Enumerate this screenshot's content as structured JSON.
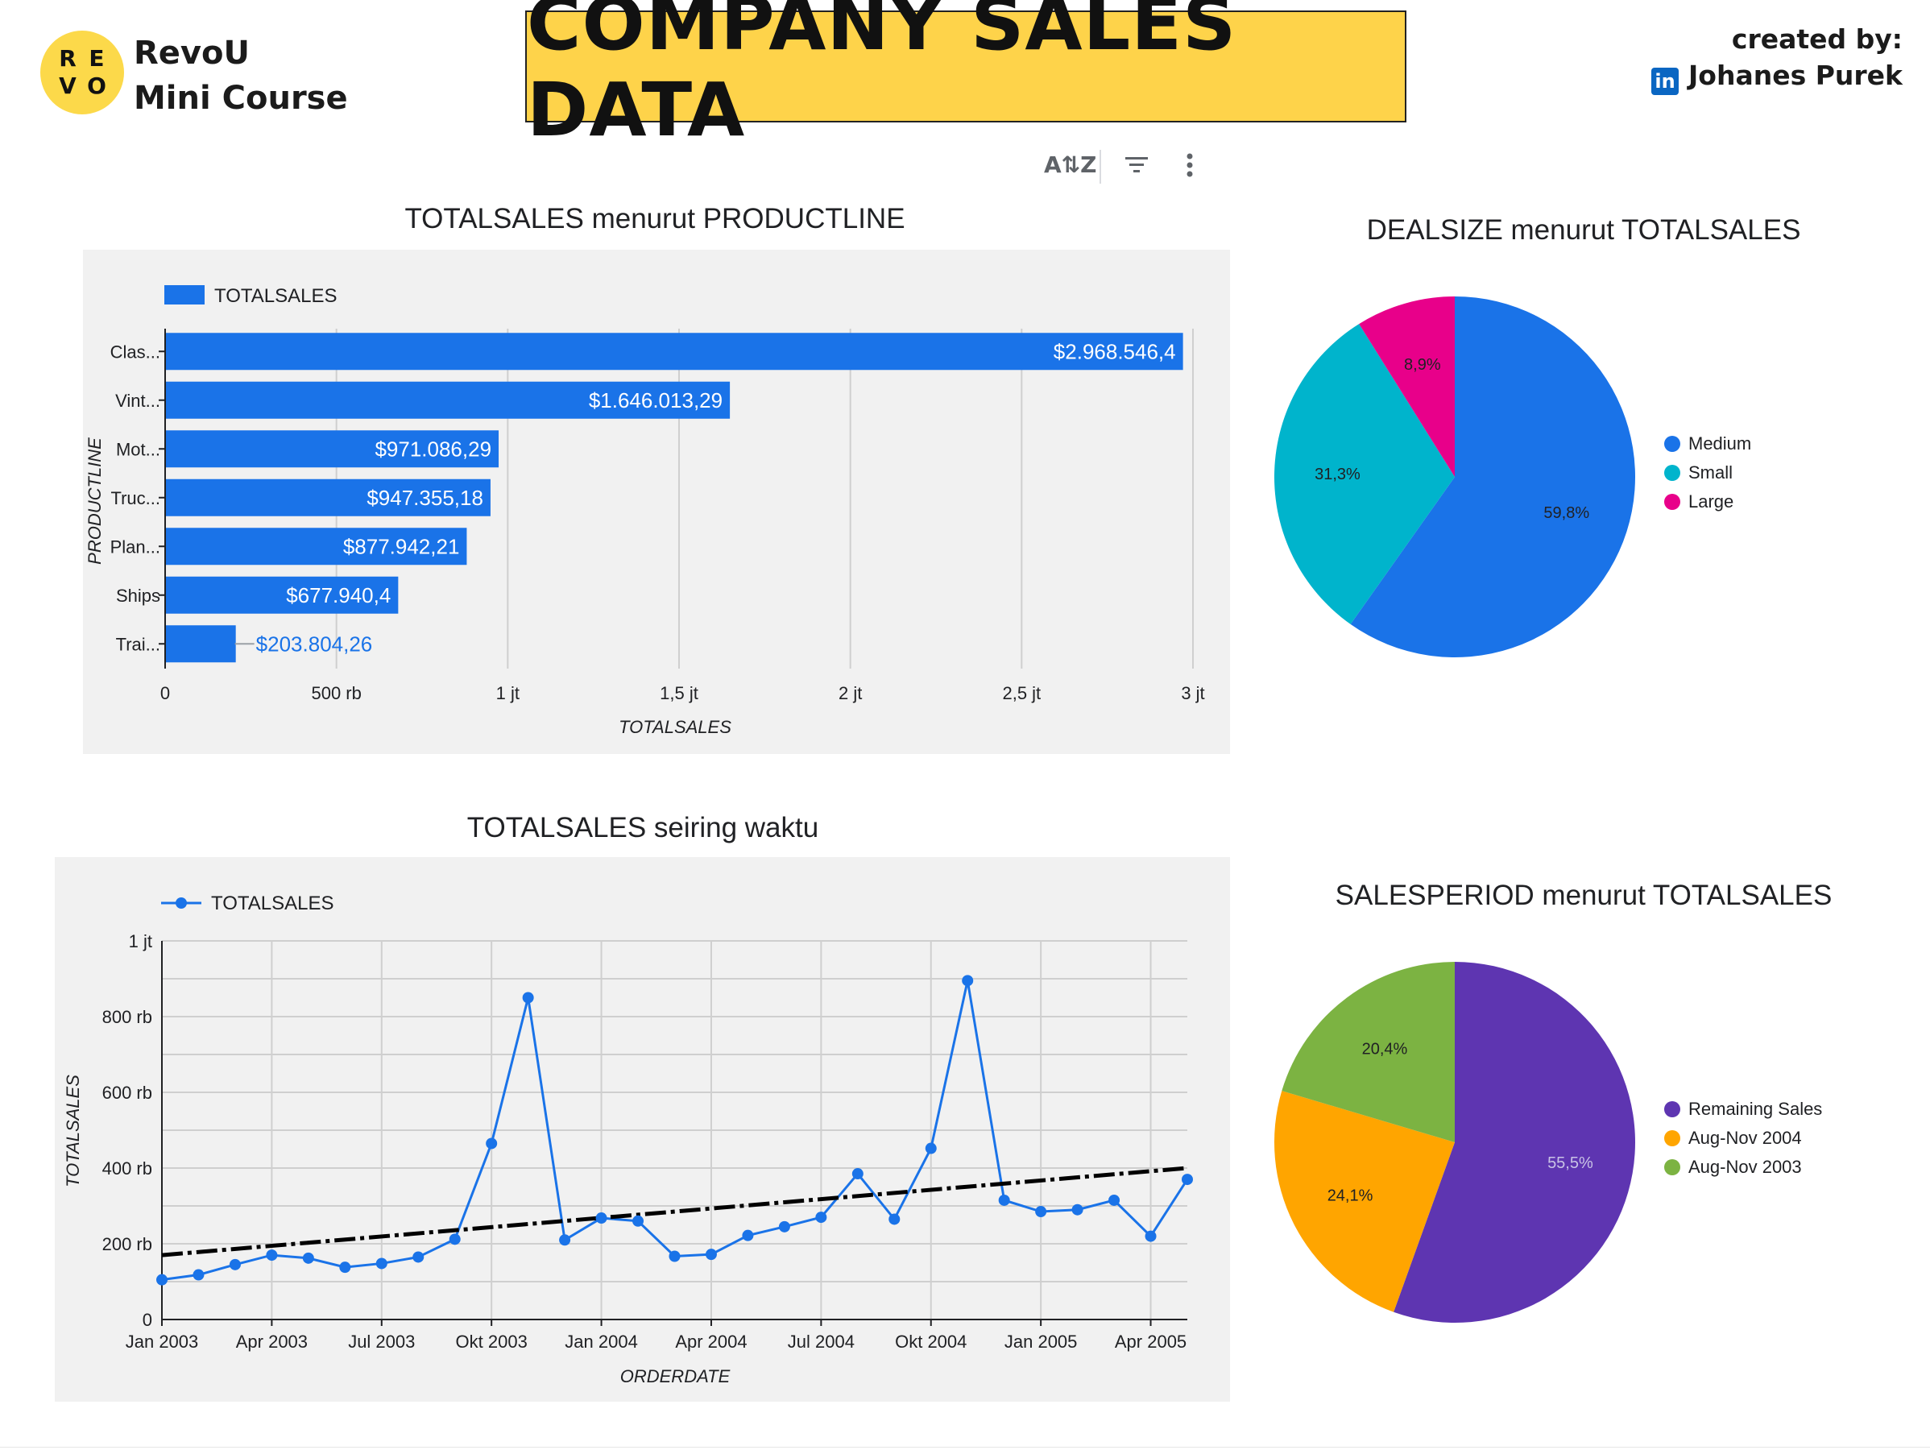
{
  "header": {
    "logo_letters": [
      "R",
      "E",
      "V",
      "O"
    ],
    "brand_line1": "RevoU",
    "brand_line2": "Mini Course",
    "title": "COMPANY SALES DATA",
    "created_label": "created by:",
    "author": "Johanes Purek",
    "linkedin_glyph": "in"
  },
  "toolbar": {
    "sort_icon": "sort-az-icon",
    "filter_icon": "filter-icon",
    "more_icon": "more-vert-icon"
  },
  "colors": {
    "brand_yellow": "#fed34a",
    "bar_blue": "#1a73e8",
    "panel_bg": "#f1f1f1",
    "medium": "#1a73e8",
    "small": "#00b4cc",
    "large": "#e8008a",
    "remaining": "#5e35b1",
    "aug_nov_2004": "#ffa500",
    "aug_nov_2003": "#7cb342"
  },
  "chart_data": [
    {
      "type": "bar",
      "orientation": "horizontal",
      "title": "TOTALSALES menurut PRODUCTLINE",
      "xlabel": "TOTALSALES",
      "ylabel": "PRODUCTLINE",
      "legend": "TOTALSALES",
      "categories": [
        "Clas...",
        "Vint...",
        "Mot...",
        "Truc...",
        "Plan...",
        "Ships",
        "Trai..."
      ],
      "values": [
        2968546.4,
        1646013.29,
        971086.29,
        947355.18,
        877942.21,
        677940.4,
        203804.26
      ],
      "value_labels": [
        "$2.968.546,4",
        "$1.646.013,29",
        "$971.086,29",
        "$947.355,18",
        "$877.942,21",
        "$677.940,4",
        "$203.804,26"
      ],
      "xlim": [
        0,
        3000000
      ],
      "xticks": [
        0,
        500000,
        1000000,
        1500000,
        2000000,
        2500000,
        3000000
      ],
      "xtick_labels": [
        "0",
        "500 rb",
        "1 jt",
        "1,5 jt",
        "2 jt",
        "2,5 jt",
        "3 jt"
      ],
      "grid": true
    },
    {
      "type": "pie",
      "title": "DEALSIZE menurut TOTALSALES",
      "slices": [
        {
          "name": "Medium",
          "value": 59.8,
          "label": "59,8%"
        },
        {
          "name": "Small",
          "value": 31.3,
          "label": "31,3%"
        },
        {
          "name": "Large",
          "value": 8.9,
          "label": "8,9%"
        }
      ]
    },
    {
      "type": "line",
      "title": "TOTALSALES seiring waktu",
      "xlabel": "ORDERDATE",
      "ylabel": "TOTALSALES",
      "legend": "TOTALSALES",
      "x": [
        "2003-01",
        "2003-02",
        "2003-03",
        "2003-04",
        "2003-05",
        "2003-06",
        "2003-07",
        "2003-08",
        "2003-09",
        "2003-10",
        "2003-11",
        "2003-12",
        "2004-01",
        "2004-02",
        "2004-03",
        "2004-04",
        "2004-05",
        "2004-06",
        "2004-07",
        "2004-08",
        "2004-09",
        "2004-10",
        "2004-11",
        "2004-12",
        "2005-01",
        "2005-02",
        "2005-03",
        "2005-04",
        "2005-05"
      ],
      "series": [
        {
          "name": "TOTALSALES",
          "values": [
            105000,
            118000,
            145000,
            170000,
            162000,
            138000,
            148000,
            165000,
            212000,
            465000,
            850000,
            210000,
            268000,
            260000,
            167000,
            172000,
            222000,
            245000,
            270000,
            385000,
            265000,
            452000,
            895000,
            315000,
            285000,
            290000,
            315000,
            220000,
            370000
          ]
        }
      ],
      "trendline": {
        "start": 170000,
        "end": 400000
      },
      "ylim": [
        0,
        1000000
      ],
      "yticks": [
        0,
        200000,
        400000,
        600000,
        800000,
        1000000
      ],
      "ytick_labels": [
        "0",
        "200 rb",
        "400 rb",
        "600 rb",
        "800 rb",
        "1 jt"
      ],
      "xtick_labels": [
        "Jan 2003",
        "Apr 2003",
        "Jul 2003",
        "Okt 2003",
        "Jan 2004",
        "Apr 2004",
        "Jul 2004",
        "Okt 2004",
        "Jan 2005",
        "Apr 2005"
      ],
      "grid": true
    },
    {
      "type": "pie",
      "title": "SALESPERIOD menurut TOTALSALES",
      "slices": [
        {
          "name": "Remaining Sales",
          "value": 55.5,
          "label": "55,5%"
        },
        {
          "name": "Aug-Nov 2004",
          "value": 24.1,
          "label": "24,1%"
        },
        {
          "name": "Aug-Nov 2003",
          "value": 20.4,
          "label": "20,4%"
        }
      ]
    }
  ]
}
